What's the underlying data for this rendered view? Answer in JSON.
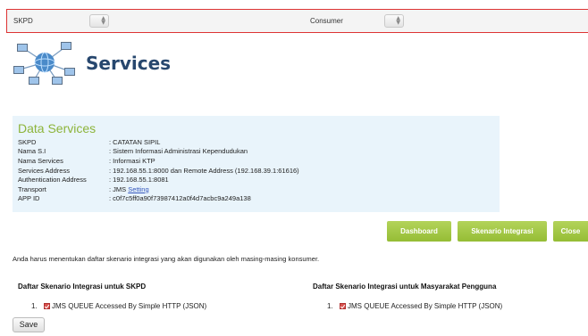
{
  "filters": {
    "skpd_label": "SKPD",
    "consumer_label": "Consumer"
  },
  "header": {
    "title": "Services"
  },
  "data_services": {
    "title": "Data Services",
    "rows": [
      {
        "key": "SKPD",
        "value": ": CATATAN SIPIL"
      },
      {
        "key": "Nama S.I",
        "value": ": Sistem Informasi Administrasi Kependudukan"
      },
      {
        "key": "Nama Services",
        "value": ": Informasi KTP"
      },
      {
        "key": "Services Address",
        "value": ": 192.168.55.1:8000 dan Remote Address (192.168.39.1:61616)"
      },
      {
        "key": "Authentication Address",
        "value": ": 192.168.55.1:8081"
      },
      {
        "key": "Transport",
        "value": ": JMS ",
        "link": "Setting"
      },
      {
        "key": "APP ID",
        "value": ": c0f7c5ff0a90f73987412a0f4d7acbc9a249a138"
      }
    ]
  },
  "actions": {
    "dashboard": "Dashboard",
    "skenario": "Skenario Integrasi",
    "close": "Close"
  },
  "instruction": "Anda harus menentukan daftar skenario integrasi yang akan digunakan oleh masing-masing konsumer.",
  "lists": {
    "skpd": {
      "heading": "Daftar Skenario Integrasi untuk SKPD",
      "items": [
        {
          "num": "1.",
          "label": "JMS QUEUE Accessed By Simple HTTP (JSON)"
        }
      ]
    },
    "masyarakat": {
      "heading": "Daftar Skenario Integrasi untuk Masyarakat Pengguna",
      "items": [
        {
          "num": "1.",
          "label": "JMS QUEUE Accessed By Simple HTTP (JSON)"
        }
      ]
    }
  },
  "save_label": "Save",
  "colors": {
    "accent_green": "#95bd35",
    "title_blue": "#27476e",
    "panel_bg": "#e9f4fb",
    "filter_border": "#dd3333"
  }
}
